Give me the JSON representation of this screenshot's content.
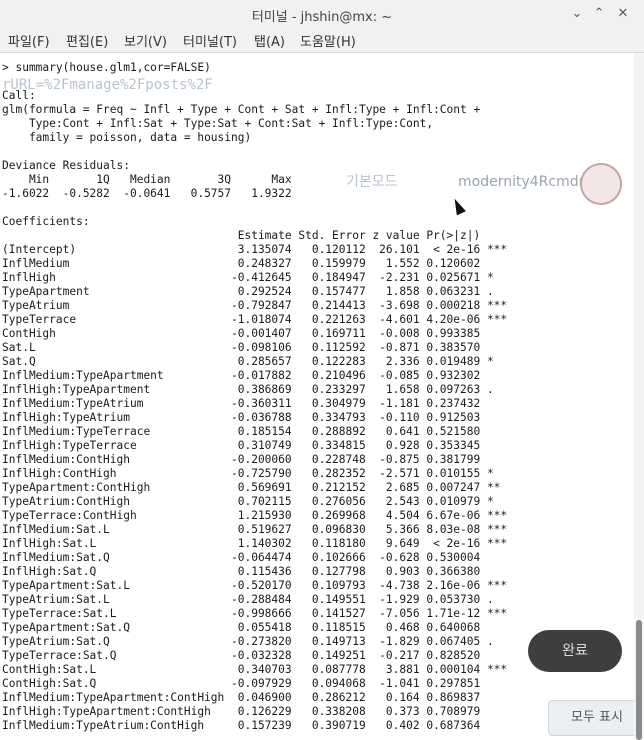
{
  "window": {
    "title": "터미널 - jhshin@mx: ~"
  },
  "menu": [
    "파일(F)",
    "편집(E)",
    "보기(V)",
    "터미널(T)",
    "탭(A)",
    "도움말(H)"
  ],
  "ghost": {
    "url_text": "rURL=%2Fmanage%2Fposts%2F",
    "mode_label": "기본모드",
    "site_name": "modernity4Rcmdr",
    "done_label": "완료",
    "show_all_label": "모두 표시"
  },
  "terminal": {
    "output": "> summary(house.glm1,cor=FALSE)\n\nCall:\nglm(formula = Freq ~ Infl + Type + Cont + Sat + Infl:Type + Infl:Cont +\n    Type:Cont + Infl:Sat + Type:Sat + Cont:Sat + Infl:Type:Cont,\n    family = poisson, data = housing)\n\nDeviance Residuals:\n    Min       1Q   Median       3Q      Max\n-1.6022  -0.5282  -0.0641   0.5757   1.9322\n\nCoefficients:\n                                   Estimate Std. Error z value Pr(>|z|)\n(Intercept)                        3.135074   0.120112  26.101  < 2e-16 ***\nInflMedium                         0.248327   0.159979   1.552 0.120602\nInflHigh                          -0.412645   0.184947  -2.231 0.025671 *\nTypeApartment                      0.292524   0.157477   1.858 0.063231 .\nTypeAtrium                        -0.792847   0.214413  -3.698 0.000218 ***\nTypeTerrace                       -1.018074   0.221263  -4.601 4.20e-06 ***\nContHigh                          -0.001407   0.169711  -0.008 0.993385\nSat.L                             -0.098106   0.112592  -0.871 0.383570\nSat.Q                              0.285657   0.122283   2.336 0.019489 *\nInflMedium:TypeApartment          -0.017882   0.210496  -0.085 0.932302\nInflHigh:TypeApartment             0.386869   0.233297   1.658 0.097263 .\nInflMedium:TypeAtrium             -0.360311   0.304979  -1.181 0.237432\nInflHigh:TypeAtrium               -0.036788   0.334793  -0.110 0.912503\nInflMedium:TypeTerrace             0.185154   0.288892   0.641 0.521580\nInflHigh:TypeTerrace               0.310749   0.334815   0.928 0.353345\nInflMedium:ContHigh               -0.200060   0.228748  -0.875 0.381799\nInflHigh:ContHigh                 -0.725790   0.282352  -2.571 0.010155 *\nTypeApartment:ContHigh             0.569691   0.212152   2.685 0.007247 **\nTypeAtrium:ContHigh                0.702115   0.276056   2.543 0.010979 *\nTypeTerrace:ContHigh               1.215930   0.269968   4.504 6.67e-06 ***\nInflMedium:Sat.L                   0.519627   0.096830   5.366 8.03e-08 ***\nInflHigh:Sat.L                     1.140302   0.118180   9.649  < 2e-16 ***\nInflMedium:Sat.Q                  -0.064474   0.102666  -0.628 0.530004\nInflHigh:Sat.Q                     0.115436   0.127798   0.903 0.366380\nTypeApartment:Sat.L               -0.520170   0.109793  -4.738 2.16e-06 ***\nTypeAtrium:Sat.L                  -0.288484   0.149551  -1.929 0.053730 .\nTypeTerrace:Sat.L                 -0.998666   0.141527  -7.056 1.71e-12 ***\nTypeApartment:Sat.Q                0.055418   0.118515   0.468 0.640068\nTypeAtrium:Sat.Q                  -0.273820   0.149713  -1.829 0.067405 .\nTypeTerrace:Sat.Q                 -0.032328   0.149251  -0.217 0.828520\nContHigh:Sat.L                     0.340703   0.087778   3.881 0.000104 ***\nContHigh:Sat.Q                    -0.097929   0.094068  -1.041 0.297851\nInflMedium:TypeApartment:ContHigh  0.046900   0.286212   0.164 0.869837\nInflHigh:TypeApartment:ContHigh    0.126229   0.338208   0.373 0.708979\nInflMedium:TypeAtrium:ContHigh     0.157239   0.390719   0.402 0.687364"
  }
}
